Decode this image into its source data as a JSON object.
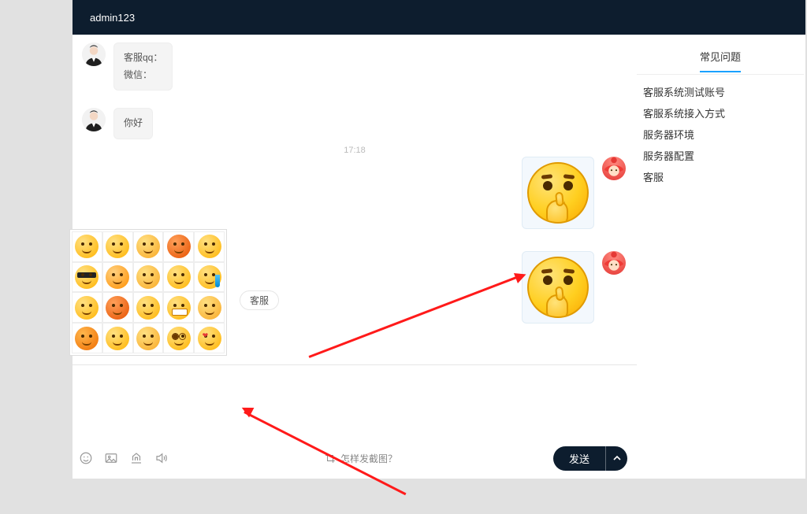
{
  "header": {
    "title": "admin123"
  },
  "sidebar": {
    "tab_label": "常见问题",
    "faqs": [
      "客服系统测试账号",
      "客服系统接入方式",
      "服务器环境",
      "服务器配置",
      "客服"
    ]
  },
  "chat": {
    "agent_msg1_line1": "客服qq：",
    "agent_msg1_line2": "微信：",
    "agent_msg2": "你好",
    "time_separator": "17:18",
    "agent_tag": "客服"
  },
  "composer": {
    "hint": "怎样发截图？",
    "send_label": "发送"
  },
  "emoji_picker": {
    "rows": 4,
    "cols": 5
  }
}
